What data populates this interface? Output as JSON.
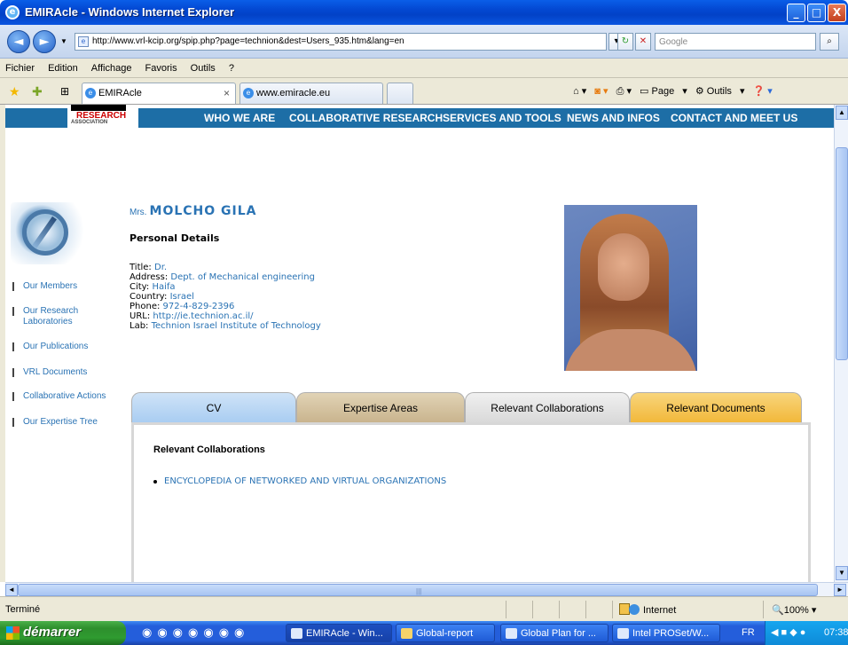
{
  "window": {
    "title": "EMIRAcle - Windows Internet Explorer",
    "minimize": "_",
    "maximize": "□",
    "close": "X"
  },
  "address": {
    "back": "◄",
    "forward": "►",
    "url": "http://www.vrl-kcip.org/spip.php?page=technion&dest=Users_935.htm&lang=en",
    "search_placeholder": "Google"
  },
  "menu": [
    "Fichier",
    "Edition",
    "Affichage",
    "Favoris",
    "Outils",
    "?"
  ],
  "tabs": [
    {
      "label": "EMIRAcle",
      "close": "×"
    },
    {
      "label": "www.emiracle.eu"
    }
  ],
  "commands": {
    "page": "Page",
    "tools": "Outils"
  },
  "site": {
    "logo_text": "RESEARCH",
    "logo_sub": "ASSOCIATION",
    "nav": [
      "WHO WE ARE",
      "COLLABORATIVE RESEARCH",
      "SERVICES AND TOOLS",
      "NEWS AND INFOS",
      "CONTACT AND MEET US"
    ],
    "sidebar": [
      "Our Members",
      "Our Research\nLaboratories",
      "Our Publications",
      "VRL Documents",
      "Collaborative Actions",
      "Our Expertise Tree"
    ]
  },
  "person": {
    "prefix": "Mrs.",
    "name": "MOLCHO GILA",
    "section_title": "Personal Details",
    "details": [
      {
        "label": "Title:",
        "value": "Dr."
      },
      {
        "label": "Address:",
        "value": "Dept. of Mechanical engineering"
      },
      {
        "label": "City:",
        "value": "Haifa"
      },
      {
        "label": "Country:",
        "value": "Israel"
      },
      {
        "label": "Phone:",
        "value": "972-4-829-2396"
      },
      {
        "label": "URL:",
        "value": "http://ie.technion.ac.il/"
      },
      {
        "label": "Lab:",
        "value": "Technion Israel Institute of Technology"
      }
    ]
  },
  "profile_tabs": [
    {
      "label": "CV",
      "color": "#a9cdf2"
    },
    {
      "label": "Expertise Areas",
      "color": "#c9b48e"
    },
    {
      "label": "Relevant Collaborations",
      "color": "#d9d9d9"
    },
    {
      "label": "Relevant Documents",
      "color": "#f2b83a"
    }
  ],
  "panel": {
    "heading": "Relevant Collaborations",
    "items": [
      "ENCYCLOPEDIA OF NETWORKED AND VIRTUAL ORGANIZATIONS"
    ]
  },
  "statusbar": {
    "status": "Terminé",
    "zone": "Internet",
    "zoom": "100%"
  },
  "taskbar": {
    "start": "démarrer",
    "tasks": [
      "EMIRAcle - Win...",
      "Global-report",
      "Global Plan for ...",
      "Intel PROSet/W..."
    ],
    "lang": "FR",
    "clock": "07:38"
  },
  "colors": {
    "link": "#2a73b4",
    "nav_bar": "#1d6ea6"
  }
}
